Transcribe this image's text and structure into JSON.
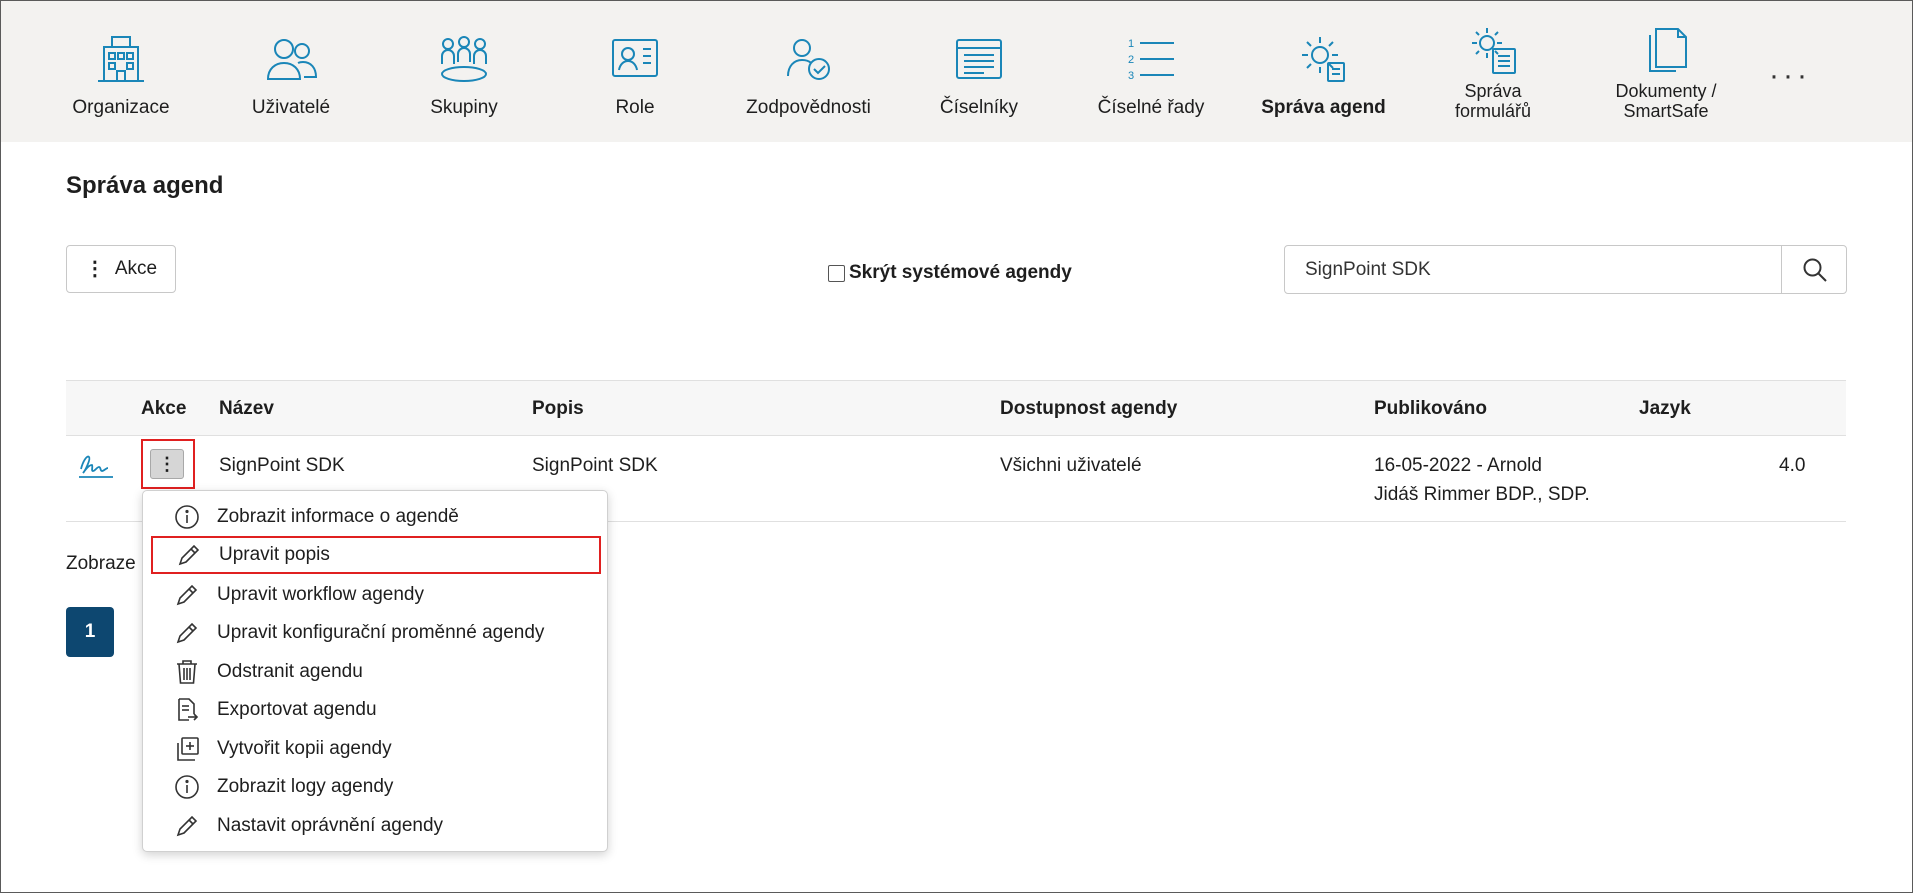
{
  "nav": {
    "items": [
      {
        "label": "Organizace",
        "icon": "organization-icon"
      },
      {
        "label": "Uživatelé",
        "icon": "users-icon"
      },
      {
        "label": "Skupiny",
        "icon": "groups-icon"
      },
      {
        "label": "Role",
        "icon": "role-card-icon"
      },
      {
        "label": "Zodpovědnosti",
        "icon": "responsibility-icon"
      },
      {
        "label": "Číselníky",
        "icon": "codelist-icon"
      },
      {
        "label": "Číselné řady",
        "icon": "numbered-list-icon"
      },
      {
        "label": "Správa agend",
        "icon": "agenda-settings-icon",
        "active": true
      },
      {
        "label_line1": "Správa",
        "label_line2": "formulářů",
        "icon": "form-settings-icon"
      },
      {
        "label_line1": "Dokumenty /",
        "label_line2": "SmartSafe",
        "icon": "documents-icon"
      }
    ],
    "more_label": "···"
  },
  "page": {
    "title": "Správa agend",
    "actions_label": "Akce",
    "hide_system_label": "Skrýt systémové agendy",
    "search_value": "SignPoint SDK"
  },
  "table": {
    "headers": {
      "akce": "Akce",
      "nazev": "Název",
      "popis": "Popis",
      "dostupnost": "Dostupnost agendy",
      "publikovano": "Publikováno",
      "jazyk": "Jazyk"
    },
    "rows": [
      {
        "icon": "signature-icon",
        "nazev": "SignPoint SDK",
        "popis": "SignPoint SDK",
        "dostupnost": "Všichni uživatelé",
        "publikovano_line1": "16-05-2022 - Arnold",
        "publikovano_line2": "Jidáš Rimmer BDP., SDP.",
        "verze": "4.0"
      }
    ]
  },
  "footer": {
    "showing_label": "Zobraze",
    "page": "1"
  },
  "menu": {
    "items": [
      {
        "label": "Zobrazit informace o agendě",
        "icon": "info-icon"
      },
      {
        "label": "Upravit popis",
        "icon": "pencil-icon",
        "highlighted": true
      },
      {
        "label": "Upravit workflow agendy",
        "icon": "pencil-icon"
      },
      {
        "label": "Upravit konfigurační proměnné agendy",
        "icon": "pencil-icon"
      },
      {
        "label": "Odstranit agendu",
        "icon": "trash-icon"
      },
      {
        "label": "Exportovat agendu",
        "icon": "export-icon"
      },
      {
        "label": "Vytvořit kopii agendy",
        "icon": "copy-add-icon"
      },
      {
        "label": "Zobrazit logy agendy",
        "icon": "info-icon"
      },
      {
        "label": "Nastavit oprávnění agendy",
        "icon": "pencil-icon"
      }
    ]
  },
  "colors": {
    "accent": "#1a86b8",
    "highlight": "#e02020",
    "pagination": "#0d4770",
    "nav_bg": "#f3f2f0"
  }
}
